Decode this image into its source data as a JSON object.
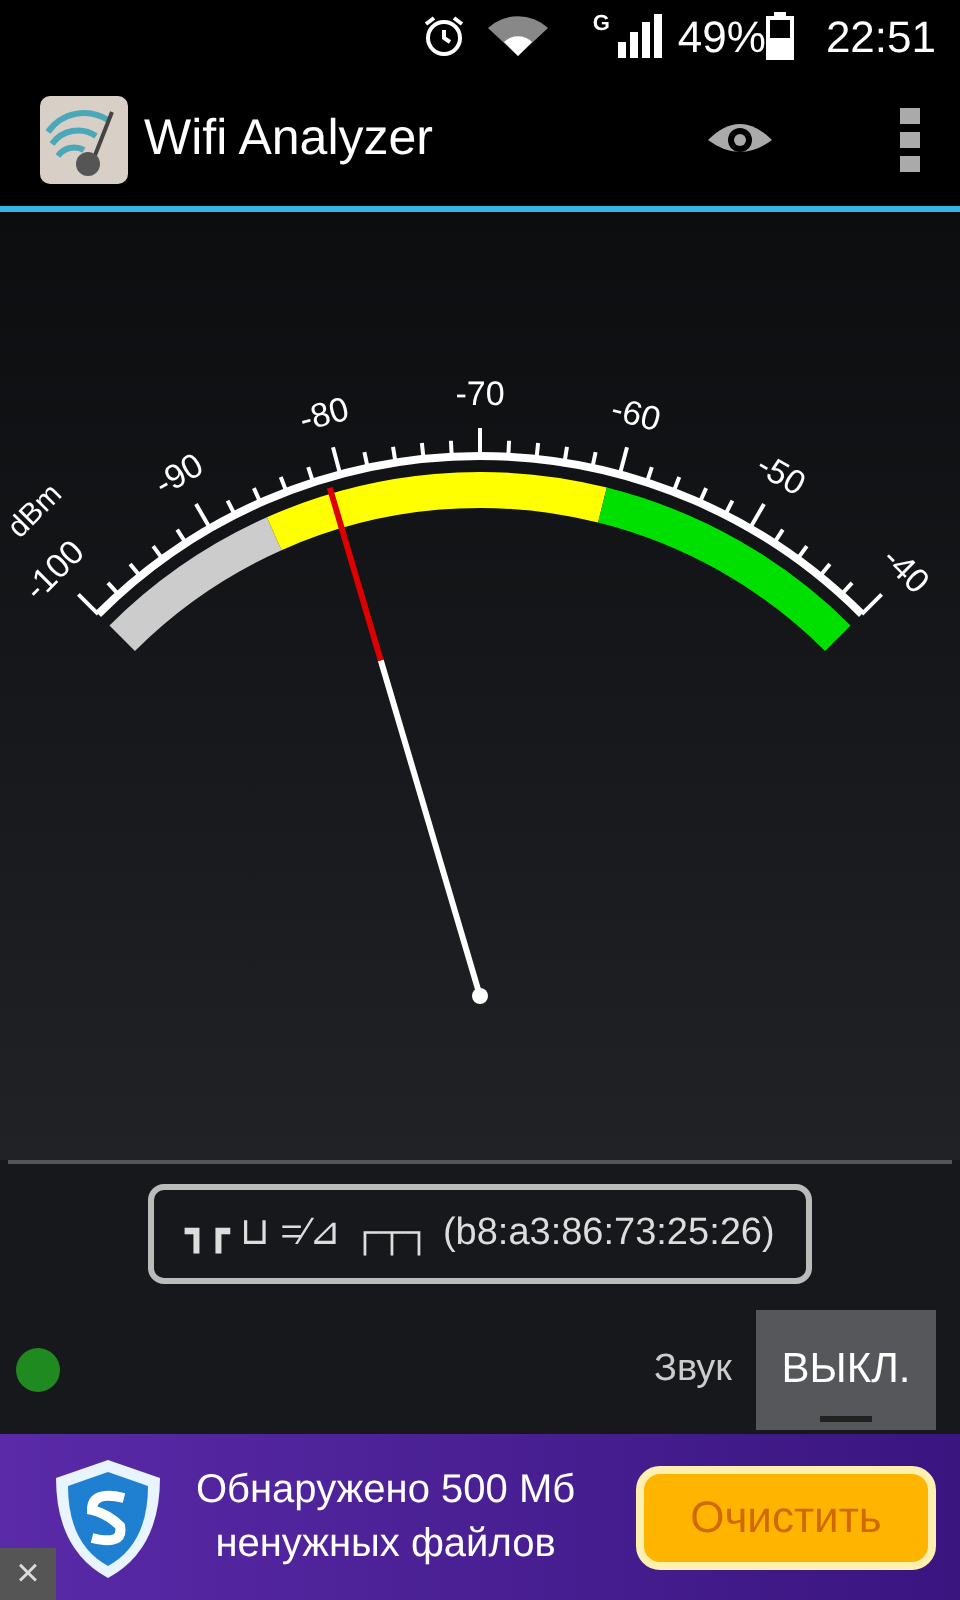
{
  "status_bar": {
    "network_type": "G",
    "battery": "49%",
    "time": "22:51"
  },
  "action_bar": {
    "title": "Wifi Analyzer"
  },
  "gauge": {
    "unit": "dBm",
    "scale_labels": [
      "-100",
      "-90",
      "-80",
      "-70",
      "-60",
      "-50",
      "-40"
    ]
  },
  "network": {
    "label": "┓┏ ⊔ =⁄⊿ ┌┬┐ (b8:a3:86:73:25:26)"
  },
  "sound": {
    "label": "Звук",
    "toggle": {
      "text": "ВЫКЛ.",
      "on": false
    }
  },
  "ad": {
    "lines": [
      "Обнаружено 500 Мб",
      "ненужных файлов"
    ],
    "button": "Очистить",
    "close": "×"
  }
}
